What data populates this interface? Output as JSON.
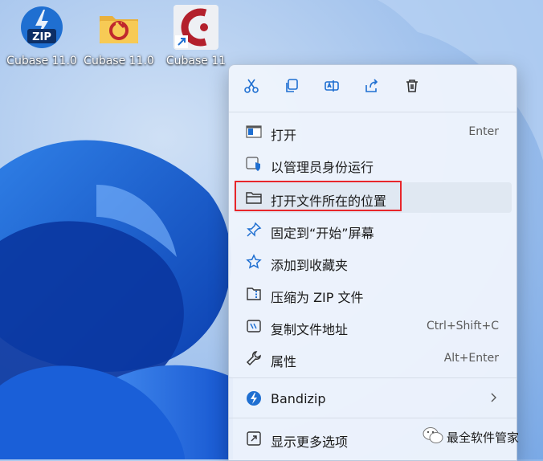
{
  "desktop": {
    "icons": [
      {
        "label": "Cubase 11.0",
        "icon": "zip-archive-icon"
      },
      {
        "label": "Cubase 11.0",
        "icon": "folder-icon"
      },
      {
        "label": "Cubase 11",
        "icon": "cubase-shortcut-icon"
      }
    ]
  },
  "context_menu": {
    "quick_actions": [
      {
        "name": "cut",
        "icon": "scissors-icon"
      },
      {
        "name": "copy",
        "icon": "copy-icon"
      },
      {
        "name": "rename",
        "icon": "rename-icon"
      },
      {
        "name": "share",
        "icon": "share-icon"
      },
      {
        "name": "delete",
        "icon": "trash-icon"
      }
    ],
    "items": [
      {
        "label": "打开",
        "shortcut": "Enter",
        "icon": "open-window-icon"
      },
      {
        "label": "以管理员身份运行",
        "shortcut": "",
        "icon": "admin-shield-icon"
      },
      {
        "label": "打开文件所在的位置",
        "shortcut": "",
        "icon": "folder-outline-icon",
        "highlighted": true
      },
      {
        "label": "固定到“开始”屏幕",
        "shortcut": "",
        "icon": "pin-icon"
      },
      {
        "label": "添加到收藏夹",
        "shortcut": "",
        "icon": "star-icon"
      },
      {
        "label": "压缩为 ZIP 文件",
        "shortcut": "",
        "icon": "zip-folder-icon"
      },
      {
        "label": "复制文件地址",
        "shortcut": "Ctrl+Shift+C",
        "icon": "copy-path-icon"
      },
      {
        "label": "属性",
        "shortcut": "Alt+Enter",
        "icon": "wrench-icon"
      }
    ],
    "bandizip": {
      "label": "Bandizip",
      "icon": "bandizip-icon",
      "submenu_icon": "chevron-right-icon"
    },
    "more_options": {
      "label": "显示更多选项",
      "icon": "more-options-icon"
    }
  },
  "watermark": {
    "text": "最全软件管家",
    "icon": "wechat-icon"
  },
  "colors": {
    "accent": "#1f6fd1",
    "highlight_box": "#e8262b",
    "menu_bg": "#eef4fc"
  }
}
